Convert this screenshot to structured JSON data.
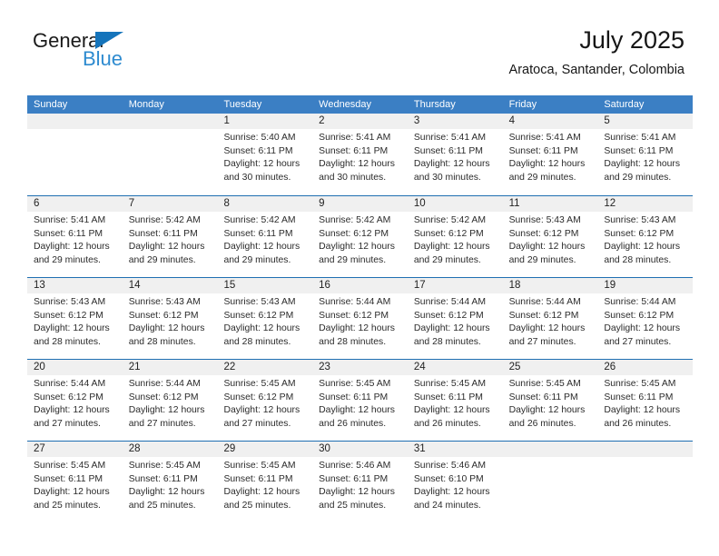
{
  "logo": {
    "word_one": "General",
    "word_two": "Blue",
    "flag_icon": "triangle-flag-icon",
    "brand_color": "#1574bb",
    "blue_text_color": "#2e8bd0"
  },
  "header": {
    "title": "July 2025",
    "subtitle": "Aratoca, Santander, Colombia"
  },
  "calendar": {
    "header_bg": "#3b7fc4",
    "week_separator_color": "#1f6fb2",
    "day_head_bg": "#f0f0f0",
    "day_names": [
      "Sunday",
      "Monday",
      "Tuesday",
      "Wednesday",
      "Thursday",
      "Friday",
      "Saturday"
    ],
    "labels": {
      "sunrise": "Sunrise:",
      "sunset": "Sunset:",
      "daylight": "Daylight:"
    },
    "weeks": [
      [
        {
          "date": "",
          "empty": true
        },
        {
          "date": "",
          "empty": true
        },
        {
          "date": "1",
          "sunrise": "Sunrise: 5:40 AM",
          "sunset": "Sunset: 6:11 PM",
          "daylight_line1": "Daylight: 12 hours",
          "daylight_line2": "and 30 minutes."
        },
        {
          "date": "2",
          "sunrise": "Sunrise: 5:41 AM",
          "sunset": "Sunset: 6:11 PM",
          "daylight_line1": "Daylight: 12 hours",
          "daylight_line2": "and 30 minutes."
        },
        {
          "date": "3",
          "sunrise": "Sunrise: 5:41 AM",
          "sunset": "Sunset: 6:11 PM",
          "daylight_line1": "Daylight: 12 hours",
          "daylight_line2": "and 30 minutes."
        },
        {
          "date": "4",
          "sunrise": "Sunrise: 5:41 AM",
          "sunset": "Sunset: 6:11 PM",
          "daylight_line1": "Daylight: 12 hours",
          "daylight_line2": "and 29 minutes."
        },
        {
          "date": "5",
          "sunrise": "Sunrise: 5:41 AM",
          "sunset": "Sunset: 6:11 PM",
          "daylight_line1": "Daylight: 12 hours",
          "daylight_line2": "and 29 minutes."
        }
      ],
      [
        {
          "date": "6",
          "sunrise": "Sunrise: 5:41 AM",
          "sunset": "Sunset: 6:11 PM",
          "daylight_line1": "Daylight: 12 hours",
          "daylight_line2": "and 29 minutes."
        },
        {
          "date": "7",
          "sunrise": "Sunrise: 5:42 AM",
          "sunset": "Sunset: 6:11 PM",
          "daylight_line1": "Daylight: 12 hours",
          "daylight_line2": "and 29 minutes."
        },
        {
          "date": "8",
          "sunrise": "Sunrise: 5:42 AM",
          "sunset": "Sunset: 6:11 PM",
          "daylight_line1": "Daylight: 12 hours",
          "daylight_line2": "and 29 minutes."
        },
        {
          "date": "9",
          "sunrise": "Sunrise: 5:42 AM",
          "sunset": "Sunset: 6:12 PM",
          "daylight_line1": "Daylight: 12 hours",
          "daylight_line2": "and 29 minutes."
        },
        {
          "date": "10",
          "sunrise": "Sunrise: 5:42 AM",
          "sunset": "Sunset: 6:12 PM",
          "daylight_line1": "Daylight: 12 hours",
          "daylight_line2": "and 29 minutes."
        },
        {
          "date": "11",
          "sunrise": "Sunrise: 5:43 AM",
          "sunset": "Sunset: 6:12 PM",
          "daylight_line1": "Daylight: 12 hours",
          "daylight_line2": "and 29 minutes."
        },
        {
          "date": "12",
          "sunrise": "Sunrise: 5:43 AM",
          "sunset": "Sunset: 6:12 PM",
          "daylight_line1": "Daylight: 12 hours",
          "daylight_line2": "and 28 minutes."
        }
      ],
      [
        {
          "date": "13",
          "sunrise": "Sunrise: 5:43 AM",
          "sunset": "Sunset: 6:12 PM",
          "daylight_line1": "Daylight: 12 hours",
          "daylight_line2": "and 28 minutes."
        },
        {
          "date": "14",
          "sunrise": "Sunrise: 5:43 AM",
          "sunset": "Sunset: 6:12 PM",
          "daylight_line1": "Daylight: 12 hours",
          "daylight_line2": "and 28 minutes."
        },
        {
          "date": "15",
          "sunrise": "Sunrise: 5:43 AM",
          "sunset": "Sunset: 6:12 PM",
          "daylight_line1": "Daylight: 12 hours",
          "daylight_line2": "and 28 minutes."
        },
        {
          "date": "16",
          "sunrise": "Sunrise: 5:44 AM",
          "sunset": "Sunset: 6:12 PM",
          "daylight_line1": "Daylight: 12 hours",
          "daylight_line2": "and 28 minutes."
        },
        {
          "date": "17",
          "sunrise": "Sunrise: 5:44 AM",
          "sunset": "Sunset: 6:12 PM",
          "daylight_line1": "Daylight: 12 hours",
          "daylight_line2": "and 28 minutes."
        },
        {
          "date": "18",
          "sunrise": "Sunrise: 5:44 AM",
          "sunset": "Sunset: 6:12 PM",
          "daylight_line1": "Daylight: 12 hours",
          "daylight_line2": "and 27 minutes."
        },
        {
          "date": "19",
          "sunrise": "Sunrise: 5:44 AM",
          "sunset": "Sunset: 6:12 PM",
          "daylight_line1": "Daylight: 12 hours",
          "daylight_line2": "and 27 minutes."
        }
      ],
      [
        {
          "date": "20",
          "sunrise": "Sunrise: 5:44 AM",
          "sunset": "Sunset: 6:12 PM",
          "daylight_line1": "Daylight: 12 hours",
          "daylight_line2": "and 27 minutes."
        },
        {
          "date": "21",
          "sunrise": "Sunrise: 5:44 AM",
          "sunset": "Sunset: 6:12 PM",
          "daylight_line1": "Daylight: 12 hours",
          "daylight_line2": "and 27 minutes."
        },
        {
          "date": "22",
          "sunrise": "Sunrise: 5:45 AM",
          "sunset": "Sunset: 6:12 PM",
          "daylight_line1": "Daylight: 12 hours",
          "daylight_line2": "and 27 minutes."
        },
        {
          "date": "23",
          "sunrise": "Sunrise: 5:45 AM",
          "sunset": "Sunset: 6:11 PM",
          "daylight_line1": "Daylight: 12 hours",
          "daylight_line2": "and 26 minutes."
        },
        {
          "date": "24",
          "sunrise": "Sunrise: 5:45 AM",
          "sunset": "Sunset: 6:11 PM",
          "daylight_line1": "Daylight: 12 hours",
          "daylight_line2": "and 26 minutes."
        },
        {
          "date": "25",
          "sunrise": "Sunrise: 5:45 AM",
          "sunset": "Sunset: 6:11 PM",
          "daylight_line1": "Daylight: 12 hours",
          "daylight_line2": "and 26 minutes."
        },
        {
          "date": "26",
          "sunrise": "Sunrise: 5:45 AM",
          "sunset": "Sunset: 6:11 PM",
          "daylight_line1": "Daylight: 12 hours",
          "daylight_line2": "and 26 minutes."
        }
      ],
      [
        {
          "date": "27",
          "sunrise": "Sunrise: 5:45 AM",
          "sunset": "Sunset: 6:11 PM",
          "daylight_line1": "Daylight: 12 hours",
          "daylight_line2": "and 25 minutes."
        },
        {
          "date": "28",
          "sunrise": "Sunrise: 5:45 AM",
          "sunset": "Sunset: 6:11 PM",
          "daylight_line1": "Daylight: 12 hours",
          "daylight_line2": "and 25 minutes."
        },
        {
          "date": "29",
          "sunrise": "Sunrise: 5:45 AM",
          "sunset": "Sunset: 6:11 PM",
          "daylight_line1": "Daylight: 12 hours",
          "daylight_line2": "and 25 minutes."
        },
        {
          "date": "30",
          "sunrise": "Sunrise: 5:46 AM",
          "sunset": "Sunset: 6:11 PM",
          "daylight_line1": "Daylight: 12 hours",
          "daylight_line2": "and 25 minutes."
        },
        {
          "date": "31",
          "sunrise": "Sunrise: 5:46 AM",
          "sunset": "Sunset: 6:10 PM",
          "daylight_line1": "Daylight: 12 hours",
          "daylight_line2": "and 24 minutes."
        },
        {
          "date": "",
          "empty": true
        },
        {
          "date": "",
          "empty": true
        }
      ]
    ]
  }
}
